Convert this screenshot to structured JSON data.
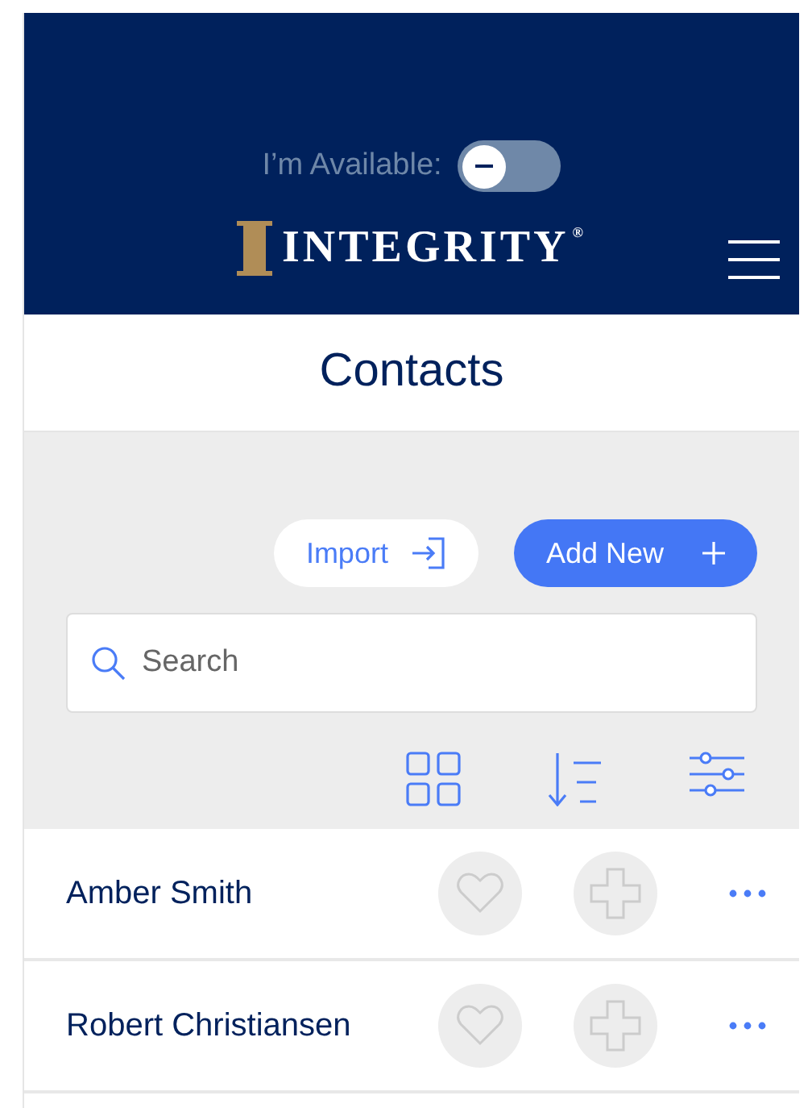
{
  "header": {
    "availability": {
      "label": "I’m Available:",
      "on": false
    },
    "logo": {
      "text": "INTEGRITY",
      "mark": "®"
    }
  },
  "page_title": "Contacts",
  "actions": {
    "import": "Import",
    "add_new": "Add New"
  },
  "search": {
    "placeholder": "Search"
  },
  "contacts": [
    {
      "name": "Amber Smith"
    },
    {
      "name": "Robert Christiansen"
    }
  ]
}
